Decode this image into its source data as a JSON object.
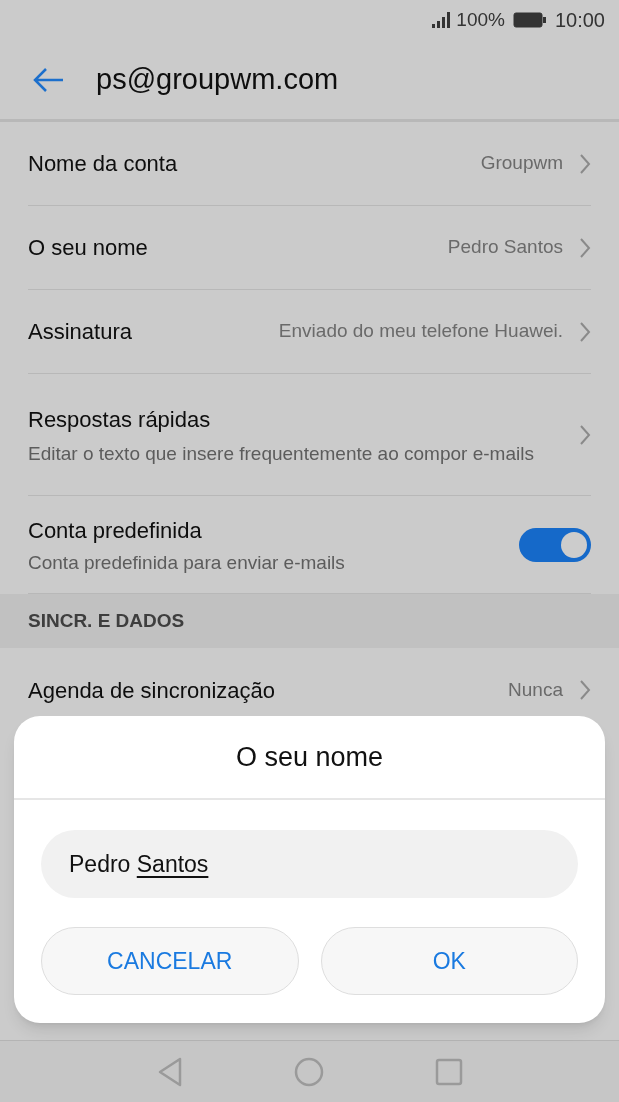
{
  "status_bar": {
    "battery_text": "100%",
    "time": "10:00"
  },
  "header": {
    "title": "ps@groupwm.com"
  },
  "settings": [
    {
      "kind": "link",
      "title": "Nome da conta",
      "value": "Groupwm"
    },
    {
      "kind": "link",
      "title": "O seu nome",
      "value": "Pedro Santos"
    },
    {
      "kind": "link",
      "title": "Assinatura",
      "value": "Enviado do meu telefone Huawei."
    },
    {
      "kind": "link",
      "title": "Respostas rápidas",
      "subtitle": "Editar o texto que insere frequentemente ao compor e-mails"
    },
    {
      "kind": "toggle",
      "title": "Conta predefinida",
      "subtitle": "Conta predefinida para enviar e-mails",
      "on": true
    },
    {
      "kind": "section",
      "title": "SINCR. E DADOS"
    },
    {
      "kind": "link",
      "title": "Agenda de sincronização",
      "value": "Nunca"
    }
  ],
  "dialog": {
    "title": "O seu nome",
    "field_value": "Pedro Santos",
    "buttons": [
      "CANCELAR",
      "OK"
    ]
  }
}
